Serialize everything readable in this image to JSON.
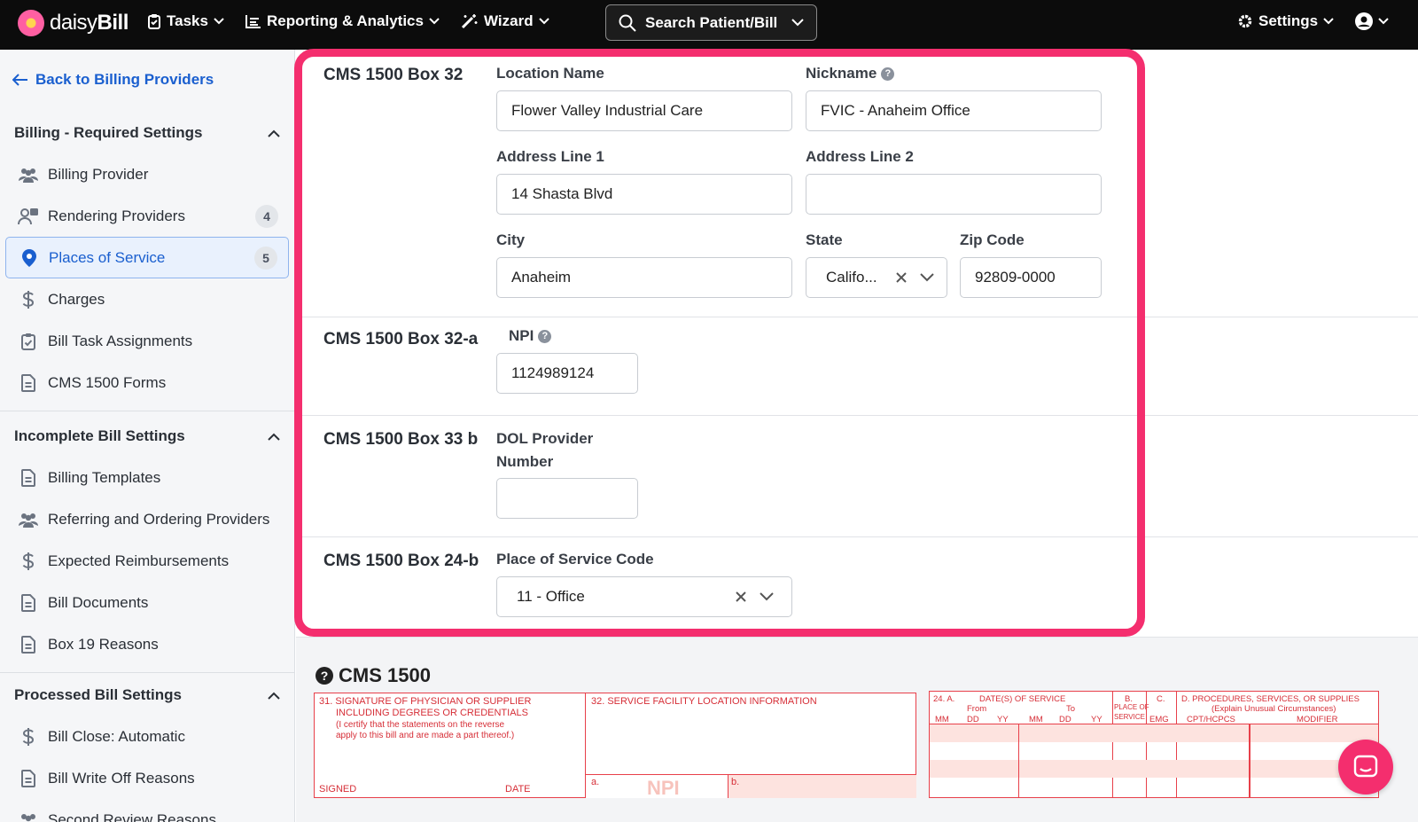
{
  "app": {
    "logo_text_light": "daisy",
    "logo_text_bold": "Bill"
  },
  "nav": {
    "tasks": "Tasks",
    "reporting": "Reporting & Analytics",
    "wizard": "Wizard",
    "search_label": "Search Patient/Bill",
    "settings": "Settings"
  },
  "sidebar": {
    "back_label": "Back to Billing Providers",
    "sections": [
      {
        "title": "Billing - Required Settings",
        "items": [
          {
            "label": "Billing Provider",
            "icon": "users-icon"
          },
          {
            "label": "Rendering Providers",
            "icon": "provider-icon",
            "badge": "4"
          },
          {
            "label": "Places of Service",
            "icon": "location-pin-icon",
            "badge": "5",
            "active": true
          },
          {
            "label": "Charges",
            "icon": "dollar-icon"
          },
          {
            "label": "Bill Task Assignments",
            "icon": "clipboard-icon"
          },
          {
            "label": "CMS 1500 Forms",
            "icon": "document-icon"
          }
        ]
      },
      {
        "title": "Incomplete Bill Settings",
        "items": [
          {
            "label": "Billing Templates",
            "icon": "document-icon"
          },
          {
            "label": "Referring and Ordering Providers",
            "icon": "users-icon"
          },
          {
            "label": "Expected Reimbursements",
            "icon": "dollar-icon"
          },
          {
            "label": "Bill Documents",
            "icon": "document-icon"
          },
          {
            "label": "Box 19 Reasons",
            "icon": "document-icon"
          }
        ]
      },
      {
        "title": "Processed Bill Settings",
        "items": [
          {
            "label": "Bill Close: Automatic",
            "icon": "dollar-icon"
          },
          {
            "label": "Bill Write Off Reasons",
            "icon": "document-icon"
          },
          {
            "label": "Second Review Reasons",
            "icon": "users-icon"
          }
        ]
      }
    ]
  },
  "form": {
    "box32": {
      "title": "CMS 1500 Box 32",
      "location_name_label": "Location Name",
      "location_name_value": "Flower Valley Industrial Care",
      "nickname_label": "Nickname",
      "nickname_value": "FVIC - Anaheim Office",
      "address1_label": "Address Line 1",
      "address1_value": "14 Shasta Blvd",
      "address2_label": "Address Line 2",
      "address2_value": "",
      "city_label": "City",
      "city_value": "Anaheim",
      "state_label": "State",
      "state_value": "Califo...",
      "zip_label": "Zip Code",
      "zip_value": "92809-0000"
    },
    "box32a": {
      "title": "CMS 1500 Box 32-a",
      "npi_label": "NPI",
      "npi_value": "1124989124"
    },
    "box33b": {
      "title": "CMS 1500 Box 33 b",
      "dol_label_line1": "DOL Provider",
      "dol_label_line2": "Number",
      "dol_value": ""
    },
    "box24b": {
      "title": "CMS 1500 Box 24-b",
      "pos_label": "Place of Service Code",
      "pos_value": "11 - Office"
    }
  },
  "cms1500": {
    "title": "CMS 1500",
    "box31_line1": "31. SIGNATURE OF PHYSICIAN OR SUPPLIER",
    "box31_line2": "INCLUDING DEGREES OR CREDENTIALS",
    "box31_line3": "(I certify that the statements on the reverse",
    "box31_line4": "apply to this bill and are made a part thereof.)",
    "signed": "SIGNED",
    "date": "DATE",
    "box32_title": "32. SERVICE FACILITY LOCATION INFORMATION",
    "box32_a": "a.",
    "box32_npi": "NPI",
    "box32_b": "b.",
    "box24_a": "24. A.",
    "box24_dates": "DATE(S) OF SERVICE",
    "box24_from": "From",
    "box24_to": "To",
    "box24_mm1": "MM",
    "box24_dd1": "DD",
    "box24_yy1": "YY",
    "box24_mm2": "MM",
    "box24_dd2": "DD",
    "box24_yy2": "YY",
    "box24_b": "B.",
    "box24_place1": "PLACE OF",
    "box24_place2": "SERVICE",
    "box24_c": "C.",
    "box24_emg": "EMG",
    "box24_d": "D. PROCEDURES, SERVICES, OR SUPPLIES",
    "box24_d_sub": "(Explain Unusual Circumstances)",
    "box24_cpt": "CPT/HCPCS",
    "box24_mod": "MODIFIER"
  },
  "colors": {
    "accent": "#f42e6e",
    "link": "#1a5fcf",
    "nav_bg": "#0c0c0c",
    "form_red": "#d62e37"
  }
}
